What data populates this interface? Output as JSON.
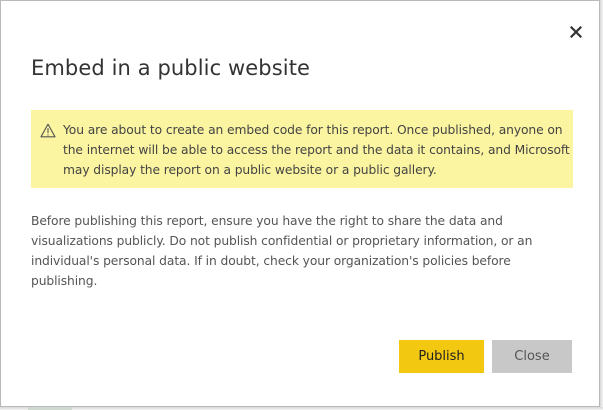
{
  "dialog": {
    "title": "Embed in a public website",
    "close_icon": "close-icon",
    "warning": {
      "icon": "warning-icon",
      "text": "You are about to create an embed code for this report. Once published, anyone on the internet will be able to access the report and the data it contains, and Microsoft may display the report on a public website or a public gallery."
    },
    "body": "Before publishing this report, ensure you have the right to share the data and visualizations publicly. Do not publish confidential or proprietary information, or an individual's personal data. If in doubt, check your organization's policies before publishing.",
    "buttons": {
      "publish_label": "Publish",
      "close_label": "Close"
    }
  },
  "colors": {
    "warning_background": "#fbf4a1",
    "publish_button": "#f2c811",
    "close_button": "#c8c8c8"
  }
}
